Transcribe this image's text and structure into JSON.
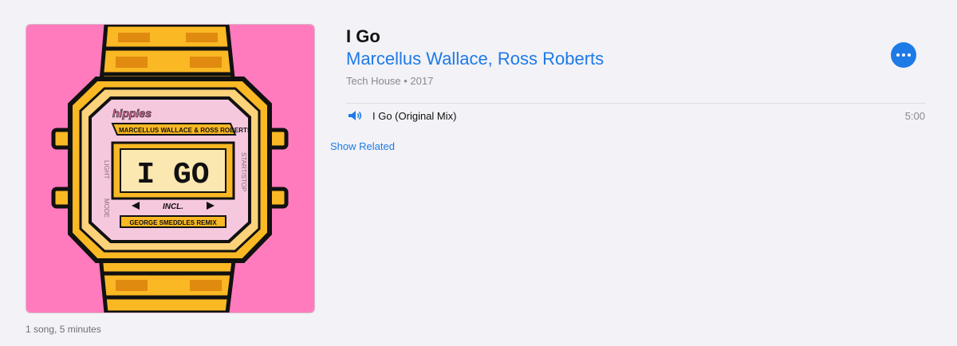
{
  "album": {
    "title": "I Go",
    "artist": "Marcellus Wallace, Ross Roberts",
    "meta": "Tech House • 2017",
    "summary": "1 song, 5 minutes",
    "artwork": {
      "brand": "hippies",
      "credit": "MARCELLUS WALLACE & ROSS ROBERTS",
      "screen_text": "I GO",
      "incl": "INCL.",
      "remix": "GEORGE SMEDDLES REMIX",
      "left_labels": [
        "LIGHT",
        "MODE"
      ],
      "right_label": "START/STOP",
      "colors": {
        "background": "#ff7bbd",
        "band": "#f9b824",
        "band_shadow": "#e08a0f",
        "bezel": "#f9b824",
        "face": "#f6c8de",
        "screen": "#fbe7b0",
        "ink": "#111111"
      }
    }
  },
  "tracks": [
    {
      "title": "I Go (Original Mix)",
      "duration": "5:00",
      "playing": true,
      "icon": "speaker-icon"
    }
  ],
  "actions": {
    "show_related": "Show Related",
    "more_icon": "ellipsis-icon"
  },
  "colors": {
    "accent": "#1e7ae6",
    "background": "#f2f2f7"
  }
}
